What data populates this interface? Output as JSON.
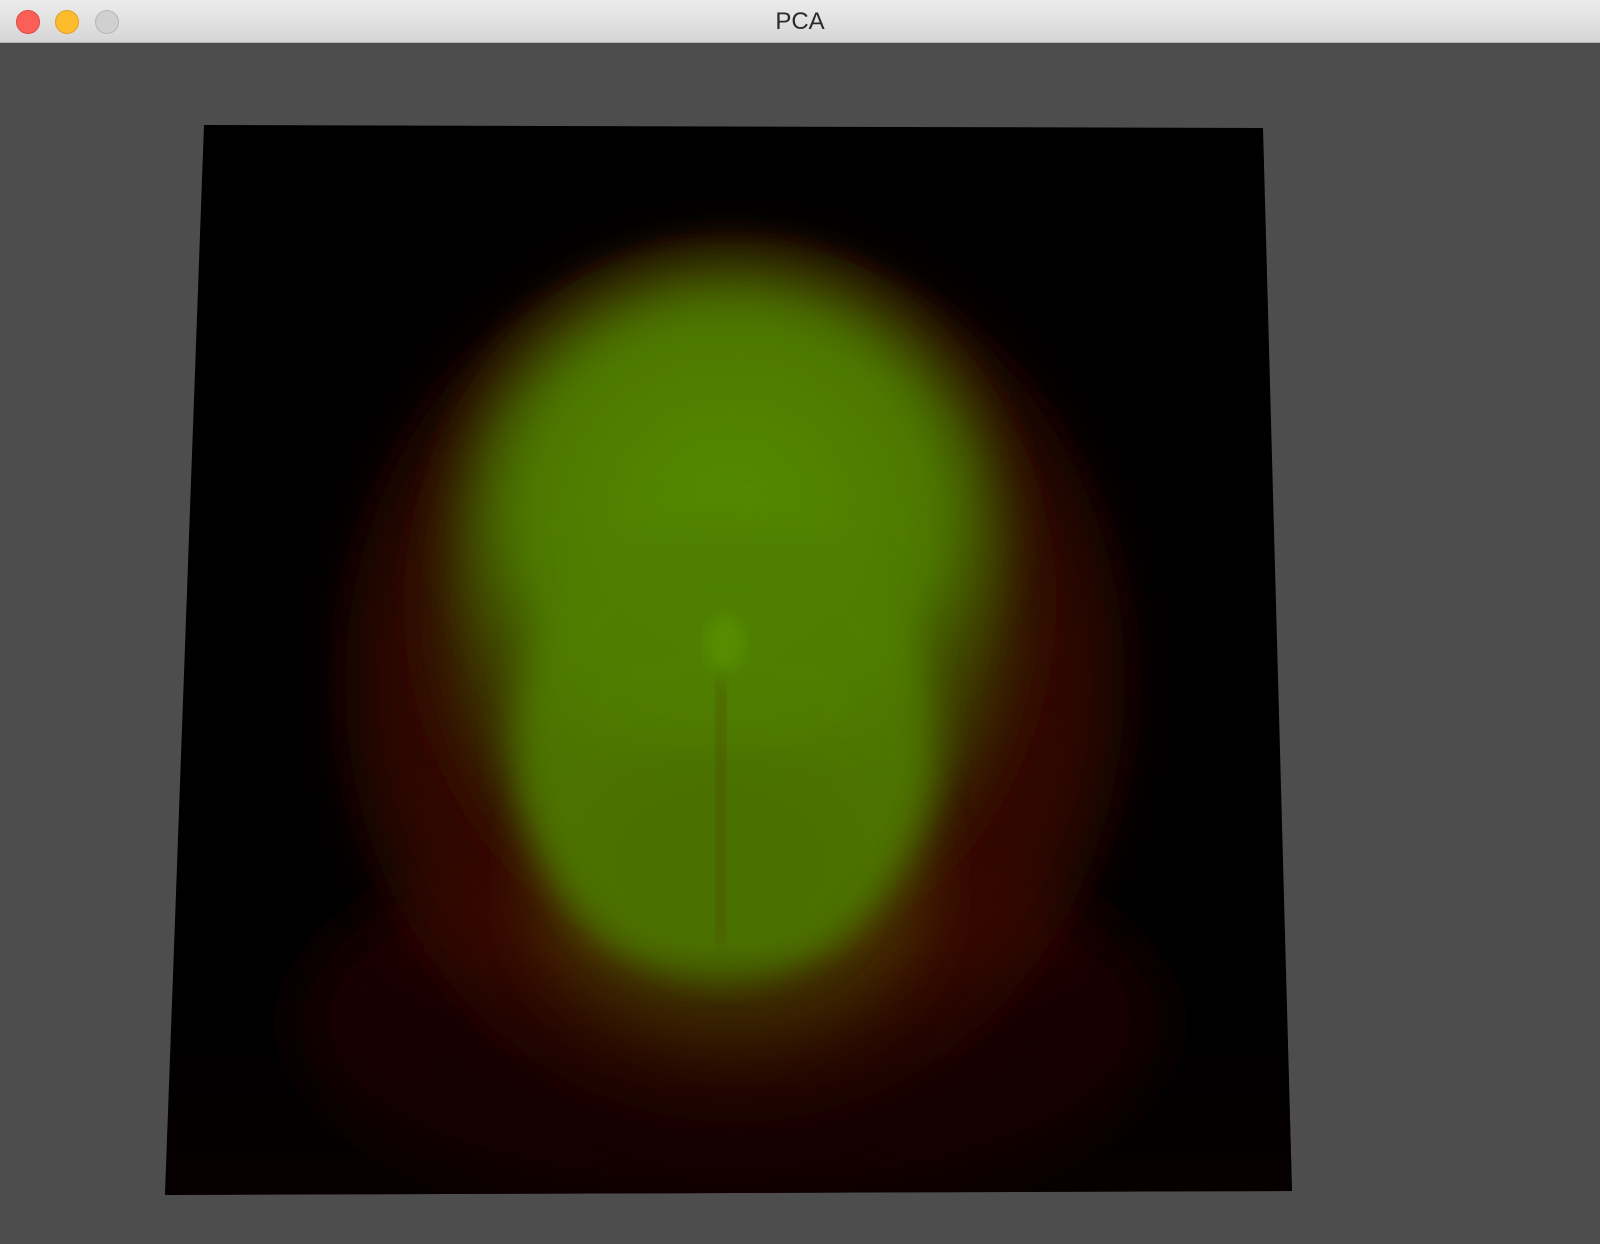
{
  "window": {
    "title": "PCA",
    "controls": {
      "close": {
        "icon": "close-icon",
        "color": "#fc5f57"
      },
      "minimize": {
        "icon": "minimize-icon",
        "color": "#fdbc2e"
      },
      "zoom": {
        "icon": "zoom-icon",
        "color": "#d1d0d1"
      }
    }
  },
  "viewport": {
    "background_color": "#4d4d4d",
    "render": {
      "description_colors": {
        "plane": "#000000",
        "inner": "#4f7e00",
        "mid": "#3f4500",
        "outer": "#4a0c00"
      }
    }
  }
}
